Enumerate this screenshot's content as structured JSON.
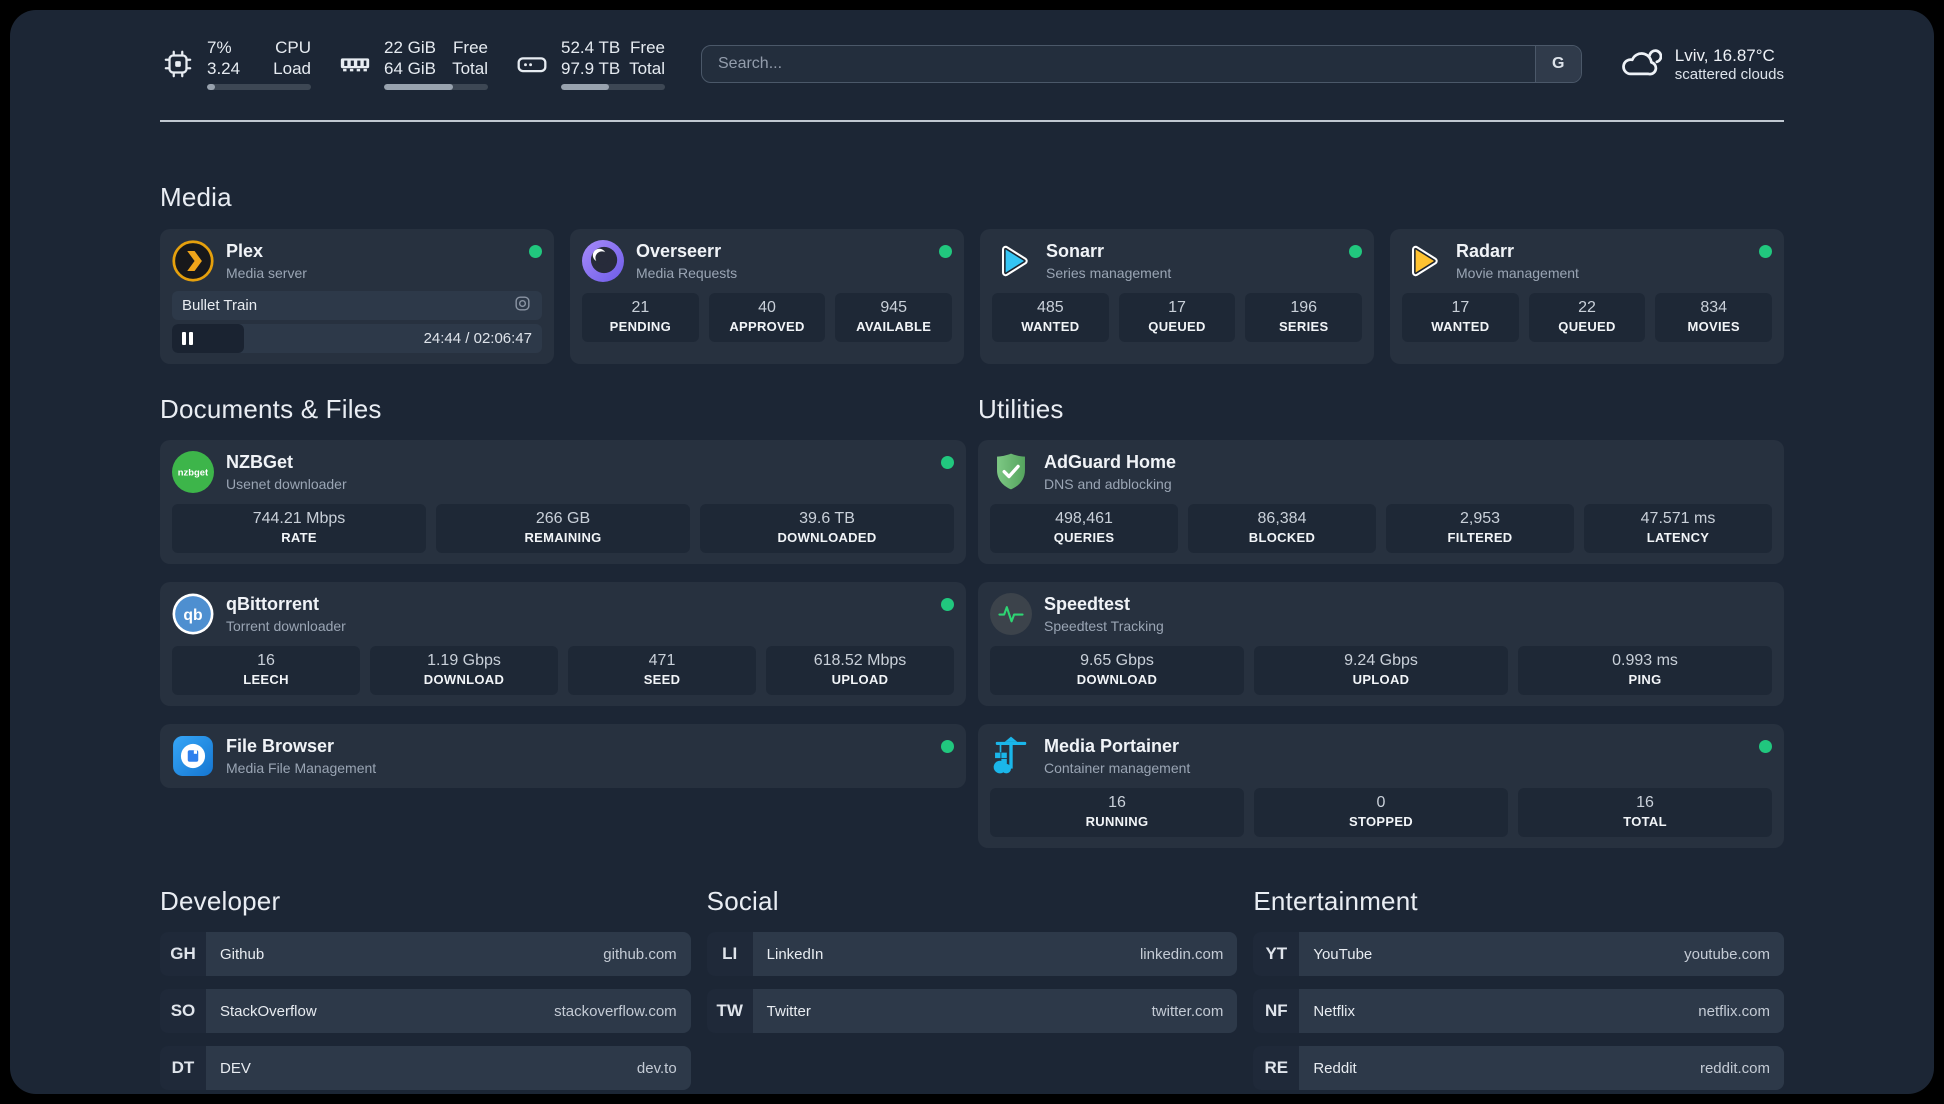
{
  "header": {
    "cpu": {
      "value1": "7%",
      "label1": "CPU",
      "value2": "3.24",
      "label2": "Load",
      "progress": 8
    },
    "ram": {
      "value1": "22 GiB",
      "label1": "Free",
      "value2": "64 GiB",
      "label2": "Total",
      "progress": 66
    },
    "disk": {
      "value1": "52.4 TB",
      "label1": "Free",
      "value2": "97.9 TB",
      "label2": "Total",
      "progress": 46
    },
    "search": {
      "placeholder": "Search...",
      "engine": "G"
    },
    "weather": {
      "title": "Lviv, 16.87°C",
      "subtitle": "scattered clouds"
    }
  },
  "media": {
    "title": "Media",
    "plex": {
      "name": "Plex",
      "desc": "Media server",
      "now_playing": {
        "title": "Bullet Train",
        "time": "24:44 / 02:06:47",
        "progress": 19.5
      }
    },
    "overseerr": {
      "name": "Overseerr",
      "desc": "Media Requests",
      "stats": [
        {
          "value": "21",
          "label": "PENDING"
        },
        {
          "value": "40",
          "label": "APPROVED"
        },
        {
          "value": "945",
          "label": "AVAILABLE"
        }
      ]
    },
    "sonarr": {
      "name": "Sonarr",
      "desc": "Series management",
      "stats": [
        {
          "value": "485",
          "label": "WANTED"
        },
        {
          "value": "17",
          "label": "QUEUED"
        },
        {
          "value": "196",
          "label": "SERIES"
        }
      ]
    },
    "radarr": {
      "name": "Radarr",
      "desc": "Movie management",
      "stats": [
        {
          "value": "17",
          "label": "WANTED"
        },
        {
          "value": "22",
          "label": "QUEUED"
        },
        {
          "value": "834",
          "label": "MOVIES"
        }
      ]
    }
  },
  "documents": {
    "title": "Documents & Files",
    "nzbget": {
      "name": "NZBGet",
      "desc": "Usenet downloader",
      "stats": [
        {
          "value": "744.21 Mbps",
          "label": "RATE"
        },
        {
          "value": "266 GB",
          "label": "REMAINING"
        },
        {
          "value": "39.6 TB",
          "label": "DOWNLOADED"
        }
      ]
    },
    "qbittorrent": {
      "name": "qBittorrent",
      "desc": "Torrent downloader",
      "stats": [
        {
          "value": "16",
          "label": "LEECH"
        },
        {
          "value": "1.19 Gbps",
          "label": "DOWNLOAD"
        },
        {
          "value": "471",
          "label": "SEED"
        },
        {
          "value": "618.52 Mbps",
          "label": "UPLOAD"
        }
      ]
    },
    "filebrowser": {
      "name": "File Browser",
      "desc": "Media File Management"
    }
  },
  "utilities": {
    "title": "Utilities",
    "adguard": {
      "name": "AdGuard Home",
      "desc": "DNS and adblocking",
      "stats": [
        {
          "value": "498,461",
          "label": "QUERIES"
        },
        {
          "value": "86,384",
          "label": "BLOCKED"
        },
        {
          "value": "2,953",
          "label": "FILTERED"
        },
        {
          "value": "47.571 ms",
          "label": "LATENCY"
        }
      ]
    },
    "speedtest": {
      "name": "Speedtest",
      "desc": "Speedtest Tracking",
      "stats": [
        {
          "value": "9.65 Gbps",
          "label": "DOWNLOAD"
        },
        {
          "value": "9.24 Gbps",
          "label": "UPLOAD"
        },
        {
          "value": "0.993 ms",
          "label": "PING"
        }
      ]
    },
    "portainer": {
      "name": "Media Portainer",
      "desc": "Container management",
      "stats": [
        {
          "value": "16",
          "label": "RUNNING"
        },
        {
          "value": "0",
          "label": "STOPPED"
        },
        {
          "value": "16",
          "label": "TOTAL"
        }
      ]
    }
  },
  "bookmarks": [
    {
      "title": "Developer",
      "links": [
        {
          "badge": "GH",
          "name": "Github",
          "url": "github.com"
        },
        {
          "badge": "SO",
          "name": "StackOverflow",
          "url": "stackoverflow.com"
        },
        {
          "badge": "DT",
          "name": "DEV",
          "url": "dev.to"
        }
      ]
    },
    {
      "title": "Social",
      "links": [
        {
          "badge": "LI",
          "name": "LinkedIn",
          "url": "linkedin.com"
        },
        {
          "badge": "TW",
          "name": "Twitter",
          "url": "twitter.com"
        }
      ]
    },
    {
      "title": "Entertainment",
      "links": [
        {
          "badge": "YT",
          "name": "YouTube",
          "url": "youtube.com"
        },
        {
          "badge": "NF",
          "name": "Netflix",
          "url": "netflix.com"
        },
        {
          "badge": "RE",
          "name": "Reddit",
          "url": "reddit.com"
        }
      ]
    }
  ],
  "colors": {
    "accent_green": "#21c77e",
    "plex_orange": "#e5a00d",
    "sonarr_blue": "#35c5f4",
    "radarr_yellow": "#ffc230",
    "portainer_blue": "#1ab6ea"
  }
}
